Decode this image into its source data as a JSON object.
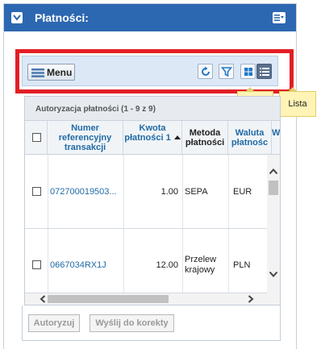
{
  "panel": {
    "title": "Płatności:"
  },
  "toolbar": {
    "menu_label": "Menu"
  },
  "tooltips": {
    "tiles": "Kafle",
    "list": "Lista"
  },
  "table": {
    "caption": "Autoryzacja płatności (1 - 9 z 9)",
    "headers": {
      "ref": "Numer referencyjny transakcji",
      "amount": "Kwota płatności 1",
      "method": "Metoda płatności",
      "currency": "Waluta płatnośc",
      "extra": "W"
    },
    "rows": [
      {
        "ref": "072700019503...",
        "amount": "1.00",
        "method": "SEPA",
        "currency": "EUR"
      },
      {
        "ref": "0667034RX1J",
        "amount": "12.00",
        "method": "Przelew krajowy",
        "currency": "PLN"
      }
    ]
  },
  "footer": {
    "authorize": "Autoryzuj",
    "send_correction": "Wyślij do korekty"
  },
  "colors": {
    "header_bg": "#2c67b1",
    "highlight": "#e31e25",
    "link": "#1f6aa5",
    "tooltip_bg": "#fff4b5"
  }
}
